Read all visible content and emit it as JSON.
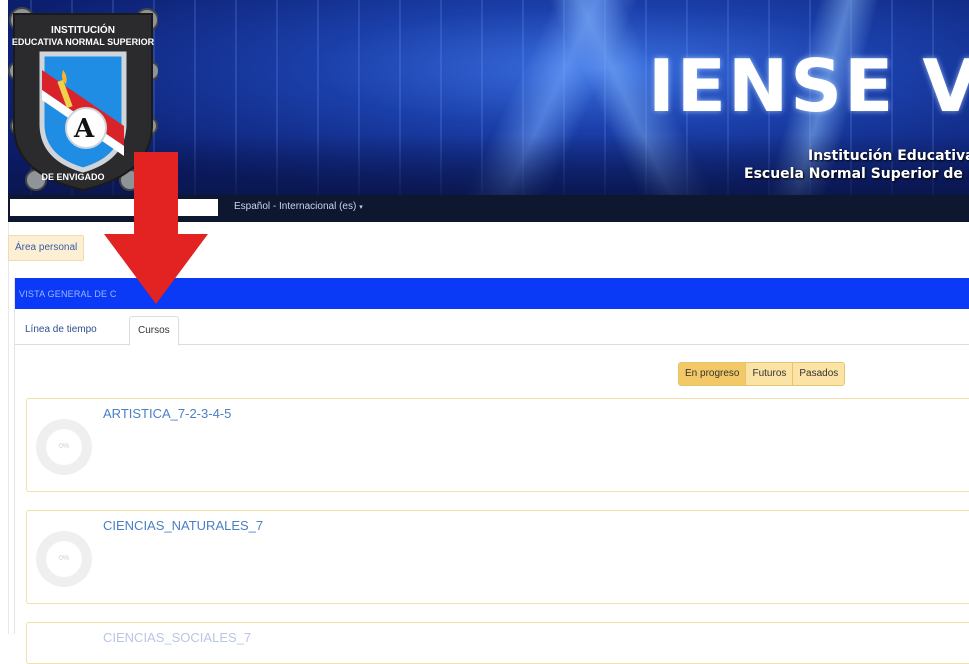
{
  "banner": {
    "logo_top_text": "INSTITUCIÓN",
    "logo_mid_text": "EDUCATIVA NORMAL SUPERIOR",
    "logo_bottom_text": "DE ENVIGADO",
    "logo_letter": "A",
    "title": "IENSE Vi",
    "subtitle_line1": "Institución Educativa",
    "subtitle_line2": "Escuela Normal Superior de E"
  },
  "navbar": {
    "search_value": "",
    "language_label": "Español - Internacional (es)",
    "language_caret": "▾"
  },
  "breadcrumb": {
    "label": "Área personal"
  },
  "block": {
    "title": "VISTA GENERAL DE C",
    "tabs": [
      {
        "label": "Línea de tiempo"
      },
      {
        "label": "Cursos"
      }
    ],
    "filters": [
      {
        "label": "En progreso"
      },
      {
        "label": "Futuros"
      },
      {
        "label": "Pasados"
      }
    ],
    "courses": [
      {
        "name": "ARTISTICA_7-2-3-4-5",
        "progress_label": "0%"
      },
      {
        "name": "CIENCIAS_NATURALES_7",
        "progress_label": "0%"
      },
      {
        "name": "CIENCIAS_SOCIALES_7",
        "progress_label": ""
      }
    ]
  },
  "colors": {
    "block_header": "#0a3af5",
    "breadcrumb_bg": "#fcefd4",
    "filter_active": "#f3c866",
    "course_link": "#4a7fc4",
    "annotation_arrow": "#e32222"
  }
}
